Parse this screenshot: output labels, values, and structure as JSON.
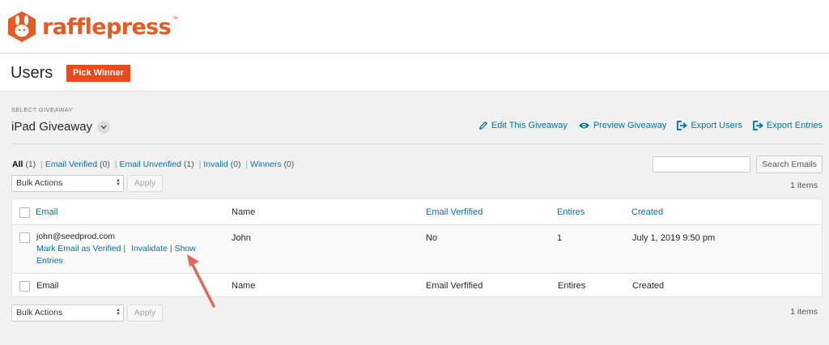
{
  "brand": {
    "name": "rafflepress",
    "tm": "™",
    "color": "#e65a24"
  },
  "header": {
    "title": "Users",
    "pick_winner": "Pick Winner"
  },
  "giveaway": {
    "select_label": "SELECT GIVEAWAY",
    "name": "iPad Giveaway",
    "actions": [
      "Edit This Giveaway",
      "Preview Giveaway",
      "Export Users",
      "Export Entries"
    ]
  },
  "filters": [
    {
      "label": "All",
      "count": "(1)"
    },
    {
      "label": "Email Verified",
      "count": "(0)"
    },
    {
      "label": "Email Unverified",
      "count": "(1)"
    },
    {
      "label": "Invalid",
      "count": "(0)"
    },
    {
      "label": "Winners",
      "count": "(0)"
    }
  ],
  "search": {
    "button": "Search Emails",
    "value": ""
  },
  "bulk": {
    "label": "Bulk Actions",
    "apply": "Apply"
  },
  "items_count": "1 items",
  "table": {
    "columns": [
      "Email",
      "Name",
      "Email Verfified",
      "Entires",
      "Created"
    ],
    "rows": [
      {
        "email": "john@seedprod.com",
        "name": "John",
        "verified": "No",
        "entries": "1",
        "created": "July 1, 2019 9:50 pm",
        "actions": [
          "Mark Email as Verified",
          "Invalidate",
          "Show Entries"
        ]
      }
    ]
  },
  "colors": {
    "accent": "#0073aa",
    "pick_button": "#e8491d",
    "arrow": "#e4665a"
  }
}
